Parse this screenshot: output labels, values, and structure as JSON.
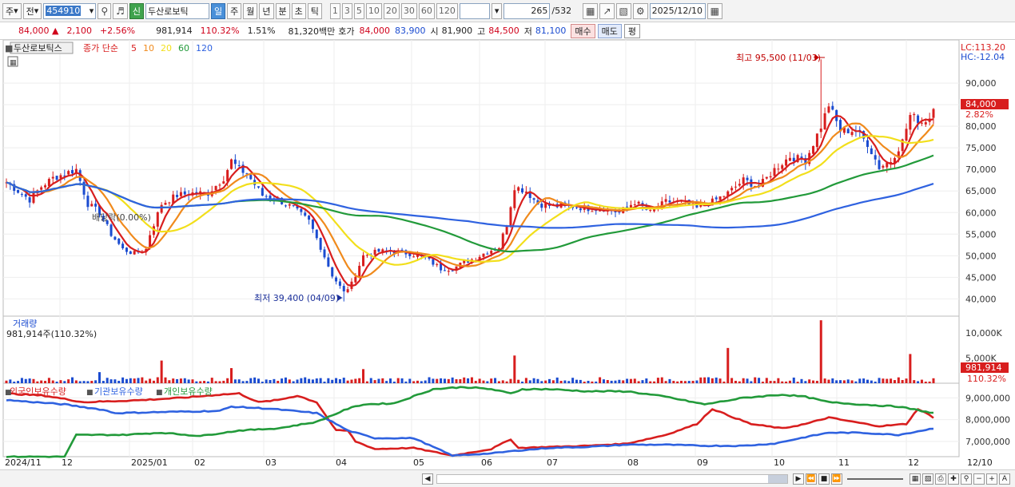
{
  "toolbar": {
    "mode": "주",
    "type": "전",
    "code": "454910",
    "badge": "신",
    "stock_name": "두산로보틱",
    "periods": [
      "일",
      "주",
      "월",
      "년",
      "분",
      "초",
      "틱"
    ],
    "active_period": "일",
    "minute_opts": [
      "1",
      "3",
      "5",
      "10",
      "20",
      "30",
      "60",
      "120"
    ],
    "count": "265",
    "count_total": "/532",
    "date": "2025/12/10"
  },
  "quote": {
    "price": "84,000",
    "change": "2,100",
    "change_pct": "+2.56%",
    "volume": "981,914",
    "vol_ratio": "110.32%",
    "turnover": "1.51%",
    "amount": "81,320백만",
    "hoga_label": "호가",
    "ask": "84,000",
    "bid": "83,900",
    "open_label": "시",
    "open": "81,900",
    "high_label": "고",
    "high": "84,500",
    "low_label": "저",
    "low": "81,100",
    "buy": "매수",
    "sell": "매도",
    "avg": "평"
  },
  "chart": {
    "legend_name": "두산로보틱스",
    "legend_type": "종가 단순",
    "ma": [
      {
        "period": "5",
        "color": "#d81e1e"
      },
      {
        "period": "10",
        "color": "#f08a1c"
      },
      {
        "period": "20",
        "color": "#f2df1b"
      },
      {
        "period": "60",
        "color": "#229a3a"
      },
      {
        "period": "120",
        "color": "#2f62e0"
      }
    ],
    "lc": "LC:113.20",
    "hc": "HC:-12.04",
    "high_annot": "최고 95,500 (11/03)",
    "low_annot": "최저 39,400 (04/09)",
    "dividend": "배당락(0.00%)",
    "price_ticks": [
      "90,000",
      "85,000",
      "80,000",
      "75,000",
      "70,000",
      "65,000",
      "60,000",
      "55,000",
      "50,000",
      "45,000",
      "40,000"
    ],
    "price_tag": "84,000",
    "price_tag_pct": "2.82%",
    "volume_label": "거래량",
    "volume_value": "981,914주(110.32%)",
    "volume_ticks": [
      "10,000K",
      "5,000K"
    ],
    "volume_tag": "981,914",
    "volume_tag_pct": "110.32%",
    "holding_labels": [
      "외국인보유수량",
      "기관보유수량",
      "개인보유수량"
    ],
    "holding_colors": [
      "#d81e1e",
      "#2f62e0",
      "#229a3a"
    ],
    "holding_ticks": [
      "9,000,000",
      "8,000,000",
      "7,000,000"
    ],
    "date_labels": [
      "2024/11",
      "12",
      "2025/01",
      "02",
      "03",
      "04",
      "05",
      "06",
      "07",
      "08",
      "09",
      "10",
      "11",
      "12"
    ],
    "right_date": "12/10"
  },
  "chart_data": {
    "type": "line",
    "months": [
      "2024/11",
      "12",
      "2025/01",
      "02",
      "03",
      "04",
      "05",
      "06",
      "07",
      "08",
      "09",
      "10",
      "11",
      "12"
    ],
    "price_ylim": [
      36000,
      100000
    ],
    "close_anchors": [
      [
        0,
        67000
      ],
      [
        6,
        63000
      ],
      [
        9,
        66000
      ],
      [
        12,
        68000
      ],
      [
        15,
        69000
      ],
      [
        18,
        70000
      ],
      [
        21,
        62000
      ],
      [
        24,
        60000
      ],
      [
        27,
        55000
      ],
      [
        30,
        51500
      ],
      [
        33,
        50500
      ],
      [
        36,
        51500
      ],
      [
        37,
        55000
      ],
      [
        40,
        62000
      ],
      [
        44,
        64000
      ],
      [
        48,
        64500
      ],
      [
        52,
        64500
      ],
      [
        56,
        68000
      ],
      [
        58,
        72000
      ],
      [
        60,
        70000
      ],
      [
        62,
        69000
      ],
      [
        66,
        64000
      ],
      [
        70,
        63000
      ],
      [
        74,
        61000
      ],
      [
        78,
        58000
      ],
      [
        81,
        52000
      ],
      [
        84,
        45500
      ],
      [
        87,
        41500
      ],
      [
        89,
        43500
      ],
      [
        92,
        50000
      ],
      [
        96,
        51000
      ],
      [
        100,
        51000
      ],
      [
        104,
        50500
      ],
      [
        108,
        49500
      ],
      [
        112,
        47000
      ],
      [
        115,
        47000
      ],
      [
        118,
        48500
      ],
      [
        121,
        49500
      ],
      [
        124,
        51000
      ],
      [
        127,
        52000
      ],
      [
        129,
        57500
      ],
      [
        131,
        66000
      ],
      [
        134,
        65000
      ],
      [
        137,
        62000
      ],
      [
        141,
        61500
      ],
      [
        145,
        61500
      ],
      [
        150,
        61000
      ],
      [
        154,
        61000
      ],
      [
        158,
        60000
      ],
      [
        162,
        62500
      ],
      [
        166,
        60000
      ],
      [
        170,
        62500
      ],
      [
        174,
        62500
      ],
      [
        178,
        61000
      ],
      [
        182,
        62500
      ],
      [
        186,
        64500
      ],
      [
        190,
        67500
      ],
      [
        194,
        66000
      ],
      [
        198,
        70000
      ],
      [
        202,
        73000
      ],
      [
        206,
        72000
      ],
      [
        210,
        80000
      ],
      [
        212,
        85000
      ],
      [
        215,
        79000
      ],
      [
        219,
        79000
      ],
      [
        222,
        76000
      ],
      [
        225,
        70500
      ],
      [
        228,
        72000
      ],
      [
        231,
        76500
      ],
      [
        233,
        82500
      ],
      [
        236,
        81000
      ],
      [
        238,
        82000
      ],
      [
        239,
        84000
      ]
    ],
    "high": {
      "value": 95500,
      "date": "11/03"
    },
    "low": {
      "value": 39400,
      "date": "04/09"
    },
    "last_close": 84000,
    "volume_ylim": [
      0,
      13000000
    ],
    "volume_last": 981914,
    "holding_ylim": [
      6300000,
      9600000
    ],
    "series": [
      {
        "name": "외국인보유수량",
        "anchors": [
          [
            0,
            9200000
          ],
          [
            10,
            9100000
          ],
          [
            20,
            8800000
          ],
          [
            35,
            8900000
          ],
          [
            45,
            9000000
          ],
          [
            55,
            9150000
          ],
          [
            60,
            9200000
          ],
          [
            65,
            8800000
          ],
          [
            70,
            8900000
          ],
          [
            75,
            9100000
          ],
          [
            80,
            8800000
          ],
          [
            85,
            7500000
          ],
          [
            88,
            7500000
          ],
          [
            90,
            7000000
          ],
          [
            95,
            6650000
          ],
          [
            105,
            6700000
          ],
          [
            115,
            6350000
          ],
          [
            125,
            6650000
          ],
          [
            130,
            7100000
          ],
          [
            132,
            6700000
          ],
          [
            140,
            6750000
          ],
          [
            150,
            6800000
          ],
          [
            160,
            6900000
          ],
          [
            170,
            7300000
          ],
          [
            178,
            7800000
          ],
          [
            182,
            8500000
          ],
          [
            186,
            8200000
          ],
          [
            192,
            7800000
          ],
          [
            200,
            7600000
          ],
          [
            206,
            7800000
          ],
          [
            212,
            8100000
          ],
          [
            215,
            8000000
          ],
          [
            225,
            7700000
          ],
          [
            232,
            7800000
          ],
          [
            235,
            8500000
          ],
          [
            238,
            8200000
          ],
          [
            239,
            8100000
          ]
        ]
      },
      {
        "name": "기관보유수량",
        "anchors": [
          [
            0,
            8900000
          ],
          [
            15,
            8700000
          ],
          [
            25,
            8450000
          ],
          [
            28,
            8300000
          ],
          [
            40,
            8350000
          ],
          [
            55,
            8400000
          ],
          [
            58,
            8600000
          ],
          [
            68,
            8500000
          ],
          [
            80,
            8300000
          ],
          [
            88,
            7500000
          ],
          [
            95,
            7150000
          ],
          [
            105,
            7150000
          ],
          [
            115,
            6350000
          ],
          [
            125,
            6450000
          ],
          [
            130,
            6550000
          ],
          [
            140,
            6700000
          ],
          [
            150,
            6750000
          ],
          [
            160,
            6850000
          ],
          [
            170,
            6850000
          ],
          [
            180,
            6800000
          ],
          [
            190,
            6800000
          ],
          [
            198,
            6900000
          ],
          [
            206,
            7200000
          ],
          [
            212,
            7400000
          ],
          [
            220,
            7400000
          ],
          [
            230,
            7300000
          ],
          [
            239,
            7600000
          ]
        ]
      },
      {
        "name": "개인보유수량",
        "anchors": [
          [
            0,
            6300000
          ],
          [
            15,
            6300000
          ],
          [
            18,
            7300000
          ],
          [
            30,
            7300000
          ],
          [
            40,
            7400000
          ],
          [
            50,
            7250000
          ],
          [
            60,
            7500000
          ],
          [
            70,
            7600000
          ],
          [
            80,
            7900000
          ],
          [
            88,
            8500000
          ],
          [
            92,
            8700000
          ],
          [
            100,
            8750000
          ],
          [
            110,
            9400000
          ],
          [
            118,
            9500000
          ],
          [
            125,
            9400000
          ],
          [
            130,
            9200000
          ],
          [
            133,
            9400000
          ],
          [
            140,
            9400000
          ],
          [
            150,
            9300000
          ],
          [
            160,
            9300000
          ],
          [
            170,
            9050000
          ],
          [
            180,
            8700000
          ],
          [
            190,
            9000000
          ],
          [
            200,
            9150000
          ],
          [
            206,
            9050000
          ],
          [
            212,
            8800000
          ],
          [
            220,
            8700000
          ],
          [
            230,
            8600000
          ],
          [
            239,
            8300000
          ]
        ]
      }
    ]
  }
}
